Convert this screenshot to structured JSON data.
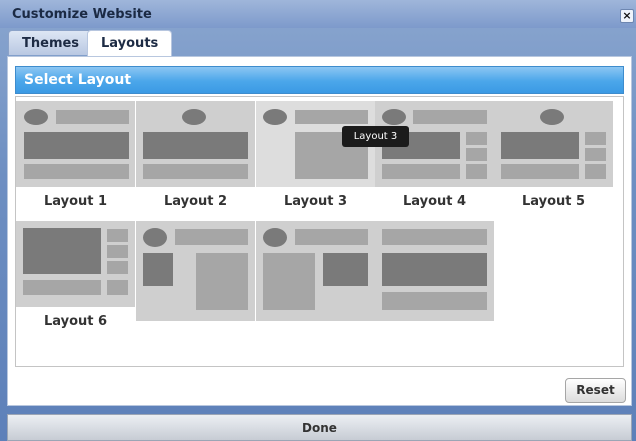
{
  "window": {
    "title": "Customize Website",
    "close_glyph": "×"
  },
  "tabs": [
    {
      "label": "Themes",
      "active": false
    },
    {
      "label": "Layouts",
      "active": true
    }
  ],
  "section": {
    "title": "Select Layout"
  },
  "layouts": [
    {
      "label": "Layout 1"
    },
    {
      "label": "Layout 2"
    },
    {
      "label": "Layout 3"
    },
    {
      "label": "Layout 4"
    },
    {
      "label": "Layout 5"
    },
    {
      "label": "Layout 6"
    }
  ],
  "tooltip": {
    "text": "Layout 3"
  },
  "buttons": {
    "reset": "Reset",
    "done": "Done"
  }
}
